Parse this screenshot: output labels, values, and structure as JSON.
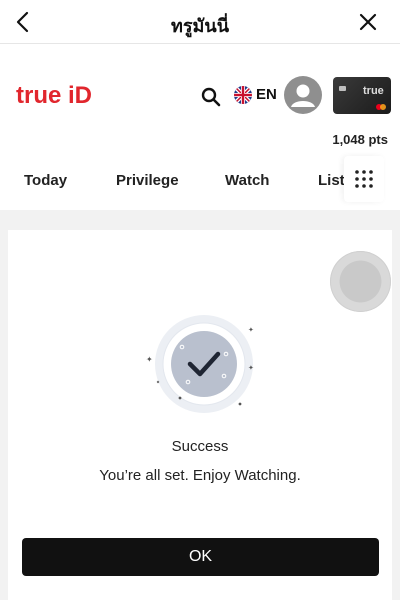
{
  "header": {
    "title": "ทรูมันนี่",
    "back_icon": "chevron-left-icon",
    "close_icon": "close-icon"
  },
  "brand": {
    "logo_text_true": "true",
    "logo_text_id": "iD",
    "logo_color": "#e1262d",
    "language": "EN",
    "search_icon": "search-icon",
    "flag_icon": "uk-flag-icon",
    "avatar_icon": "user-avatar-icon",
    "card_brand": "true"
  },
  "points": "1,048 pts",
  "tabs": [
    {
      "label": "Today"
    },
    {
      "label": "Privilege"
    },
    {
      "label": "Watch"
    },
    {
      "label": "List"
    }
  ],
  "grid_icon": "grid-menu-icon",
  "dialog": {
    "status_icon": "success-check-icon",
    "title": "Success",
    "message": "You’re all set. Enjoy Watching.",
    "ok_label": "OK"
  },
  "colors": {
    "primary_button": "#111111",
    "brand_red": "#e1262d",
    "icon_circle": "#b9c0ce"
  }
}
